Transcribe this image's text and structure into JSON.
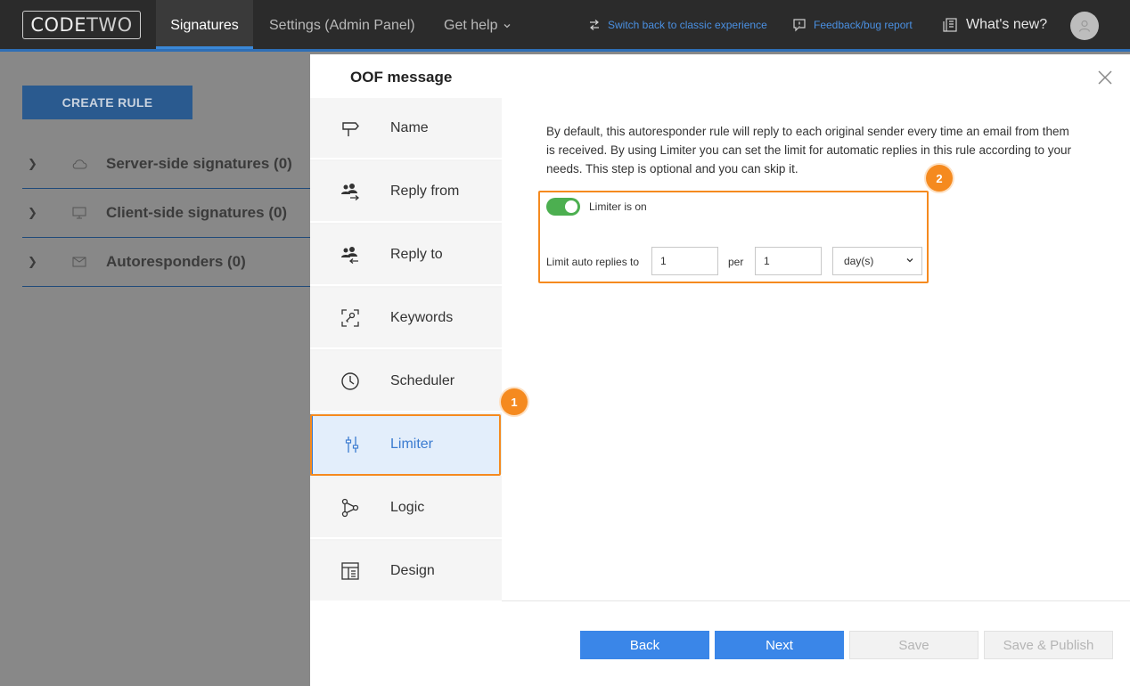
{
  "topbar": {
    "logo_code": "CODE",
    "logo_two": "TWO",
    "nav": [
      "Signatures",
      "Settings (Admin Panel)",
      "Get help"
    ],
    "switch_link": "Switch back to classic experience",
    "feedback_link": "Feedback/bug report",
    "whats_new": "What's new?"
  },
  "left": {
    "create_rule": "CREATE RULE",
    "tree": [
      {
        "label": "Server-side signatures (0)",
        "icon": "cloud-icon"
      },
      {
        "label": "Client-side signatures (0)",
        "icon": "monitor-icon"
      },
      {
        "label": "Autoresponders (0)",
        "icon": "mail-reply-icon"
      }
    ]
  },
  "modal": {
    "title": "OOF message",
    "steps": [
      "Name",
      "Reply from",
      "Reply to",
      "Keywords",
      "Scheduler",
      "Limiter",
      "Logic",
      "Design"
    ],
    "active_step": "Limiter",
    "description": "By default, this autoresponder rule will reply to each original sender every time an email from them is received. By using Limiter you can set the limit for automatic replies in this rule according to your needs. This step is optional and you can skip it.",
    "limiter_toggle_label": "Limiter is on",
    "limit_label": "Limit auto replies to",
    "limit_count": "1",
    "per_label": "per",
    "per_count": "1",
    "period_unit": "day(s)",
    "badges": [
      "1",
      "2"
    ],
    "buttons": {
      "back": "Back",
      "next": "Next",
      "save": "Save",
      "save_publish": "Save & Publish"
    }
  },
  "colors": {
    "accent": "#3a86e8",
    "highlight": "#f58a1f",
    "toggle_on": "#4caf50"
  }
}
